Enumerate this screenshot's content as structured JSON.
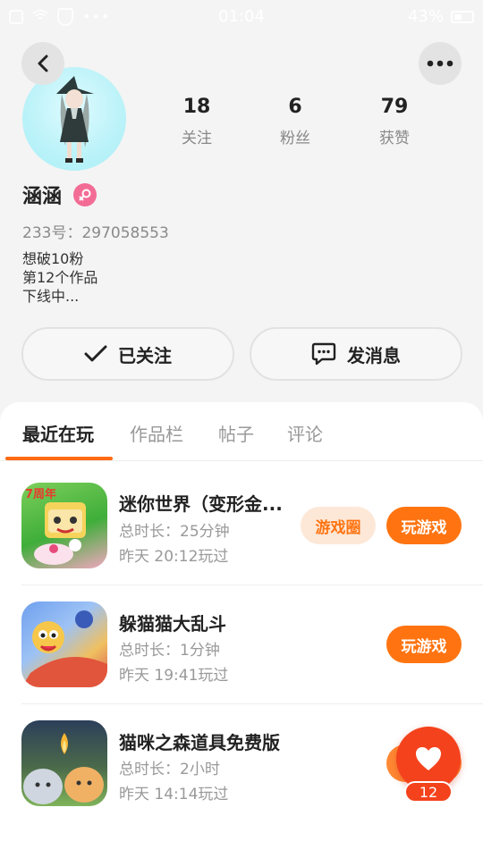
{
  "status_bar": {
    "time": "01:04",
    "battery": "43%",
    "dots": "•••"
  },
  "profile": {
    "username": "涵涵",
    "user_id": "233号：297058553",
    "bio": [
      "想破10粉",
      "第12个作品",
      "下线中..."
    ],
    "stats": [
      {
        "value": "18",
        "label": "关注"
      },
      {
        "value": "6",
        "label": "粉丝"
      },
      {
        "value": "79",
        "label": "获赞"
      }
    ],
    "follow_label": "已关注",
    "message_label": "发消息"
  },
  "tabs": [
    "最近在玩",
    "作品栏",
    "帖子",
    "评论"
  ],
  "games": [
    {
      "title": "迷你世界（变形金...",
      "duration": "总时长：25分钟",
      "last_played": "昨天 20:12玩过",
      "circle_label": "游戏圈",
      "play_label": "玩游戏",
      "icon_badge": "7周年"
    },
    {
      "title": "躲猫猫大乱斗",
      "duration": "总时长：1分钟",
      "last_played": "昨天 19:41玩过",
      "play_label": "玩游戏"
    },
    {
      "title": "猫咪之森道具免费版",
      "duration": "总时长：2小时",
      "last_played": "昨天 14:14玩过"
    }
  ],
  "like_count": "12",
  "colors": {
    "accent": "#ff7411",
    "like": "#f4421c",
    "gender": "#f36c96"
  }
}
